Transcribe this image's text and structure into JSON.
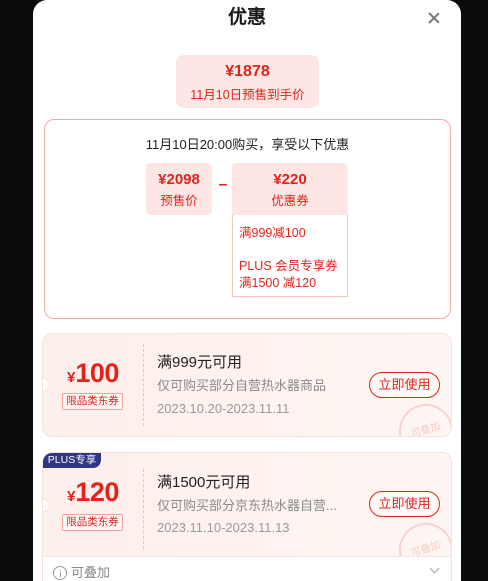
{
  "modal": {
    "title": "优惠"
  },
  "summary": {
    "price": "¥1878",
    "label": "11月10日预售到手价"
  },
  "breakdown": {
    "heading": "11月10日20:00购买，享受以下优惠",
    "presale_price": "¥2098",
    "presale_label": "预售价",
    "operator": "–",
    "coupon_price": "¥220",
    "coupon_label": "优惠券",
    "coupon_lines": [
      "满999减100",
      "PLUS 会员专享券",
      "满1500 减120"
    ]
  },
  "coupons": [
    {
      "currency": "¥",
      "amount": "100",
      "tag": "限品类东券",
      "condition": "满999元可用",
      "description": "仅可购买部分自营热水器商品",
      "validity": "2023.10.20-2023.11.11",
      "button": "立即使用",
      "stamp": "可叠加"
    },
    {
      "badge": "PLUS专享",
      "currency": "¥",
      "amount": "120",
      "tag": "限品类东券",
      "condition": "满1500元可用",
      "description": "仅可购买部分京东热水器自营...",
      "validity": "2023.11.10-2023.11.13",
      "button": "立即使用",
      "stamp": "可叠加"
    }
  ],
  "footer": {
    "label": "可叠加"
  },
  "colors": {
    "accent": "#e2231a",
    "pink_bg": "#fde6e4",
    "plus_badge": "#2f3782"
  },
  "icons": {
    "close": "close-icon",
    "info": "info-icon",
    "expand": "chevron-down-icon"
  }
}
